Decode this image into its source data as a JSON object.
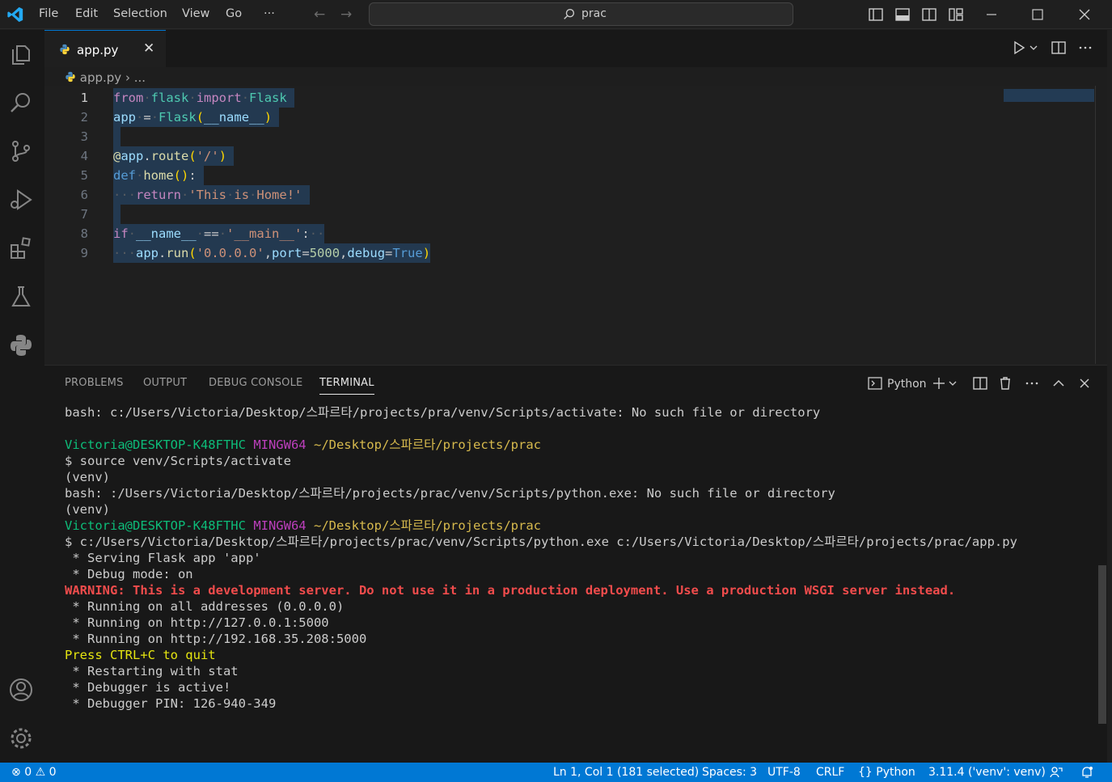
{
  "menu": [
    "File",
    "Edit",
    "Selection",
    "View",
    "Go",
    "···"
  ],
  "search": {
    "text": "prac"
  },
  "tab": {
    "label": "app.py",
    "close": "✕"
  },
  "breadcrumb": {
    "file": "app.py",
    "sep": "›",
    "rest": "..."
  },
  "editor": {
    "line_numbers": [
      "1",
      "2",
      "3",
      "4",
      "5",
      "6",
      "7",
      "8",
      "9"
    ]
  },
  "panel": {
    "tabs": [
      "PROBLEMS",
      "OUTPUT",
      "DEBUG CONSOLE",
      "TERMINAL"
    ],
    "terminal_label": "Python"
  },
  "terminal": {
    "l1": "bash: c:/Users/Victoria/Desktop/스파르타/projects/pra/venv/Scripts/activate: No such file or directory",
    "prompt_user": "Victoria@DESKTOP-K48FTHC",
    "prompt_env": "MINGW64",
    "prompt_path": "~/Desktop/스파르타/projects/prac",
    "l3": "$ source venv/Scripts/activate",
    "l4": "(venv)",
    "l5": "bash: :/Users/Victoria/Desktop/스파르타/projects/prac/venv/Scripts/python.exe: No such file or directory",
    "l6": "(venv)",
    "l8": "$ c:/Users/Victoria/Desktop/스파르타/projects/prac/venv/Scripts/python.exe c:/Users/Victoria/Desktop/스파르타/projects/prac/app.py",
    "l9": " * Serving Flask app 'app'",
    "l10": " * Debug mode: on",
    "l11": "WARNING: This is a development server. Do not use it in a production deployment. Use a production WSGI server instead.",
    "l12": " * Running on all addresses (0.0.0.0)",
    "l13": " * Running on http://127.0.0.1:5000",
    "l14": " * Running on http://192.168.35.208:5000",
    "l15": "Press CTRL+C to quit",
    "l16": " * Restarting with stat",
    "l17": " * Debugger is active!",
    "l18": " * Debugger PIN: 126-940-349"
  },
  "status": {
    "errors": "0",
    "warnings": "0",
    "position": "Ln 1, Col 1 (181 selected)",
    "spaces": "Spaces: 3",
    "encoding": "UTF-8",
    "eol": "CRLF",
    "language": "Python",
    "interpreter": "3.11.4 ('venv': venv)"
  },
  "colors": {
    "accent": "#0078d4",
    "statusbar": "#0078d4"
  }
}
